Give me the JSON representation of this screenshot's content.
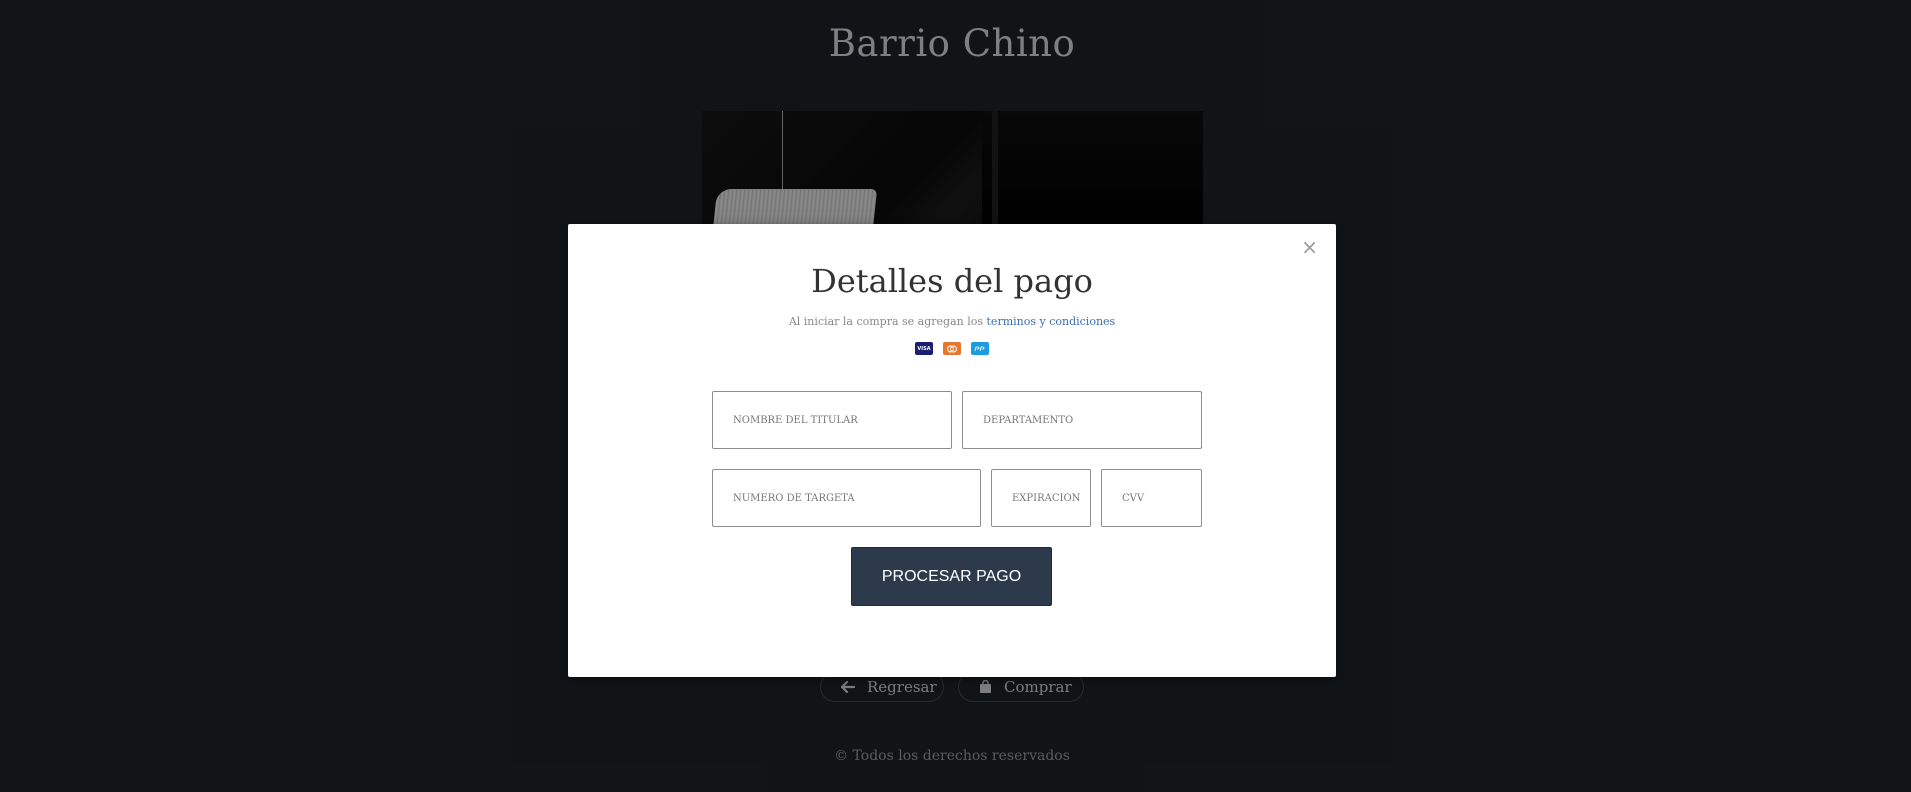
{
  "page": {
    "title": "Barrio Chino"
  },
  "actions": {
    "back_label": "Regresar",
    "buy_label": "Comprar",
    "back_icon": "arrow-left-icon",
    "buy_icon": "shopping-bag-icon"
  },
  "footer": {
    "text": "© Todos los derechos reservados"
  },
  "modal": {
    "close_glyph": "×",
    "title": "Detalles del pago",
    "subtitle_prefix": "Al iniciar la compra se agregan los ",
    "terms_link": "terminos y condiciones",
    "card_icons": [
      "visa-icon",
      "mastercard-icon",
      "paypal-icon"
    ],
    "card_labels": {
      "visa": "VISA"
    },
    "fields": {
      "holder_placeholder": "NOMBRE DEL TITULAR",
      "department_placeholder": "DEPARTAMENTO",
      "card_number_placeholder": "NUMERO DE TARGETA",
      "expiration_placeholder": "EXPIRACION",
      "cvv_placeholder": "CVV"
    },
    "submit_label": "PROCESAR PAGO"
  },
  "colors": {
    "background": "#1b1f22",
    "modal_bg": "#ffffff",
    "submit_bg": "#2c3a4c",
    "link": "#3a6fb0"
  }
}
